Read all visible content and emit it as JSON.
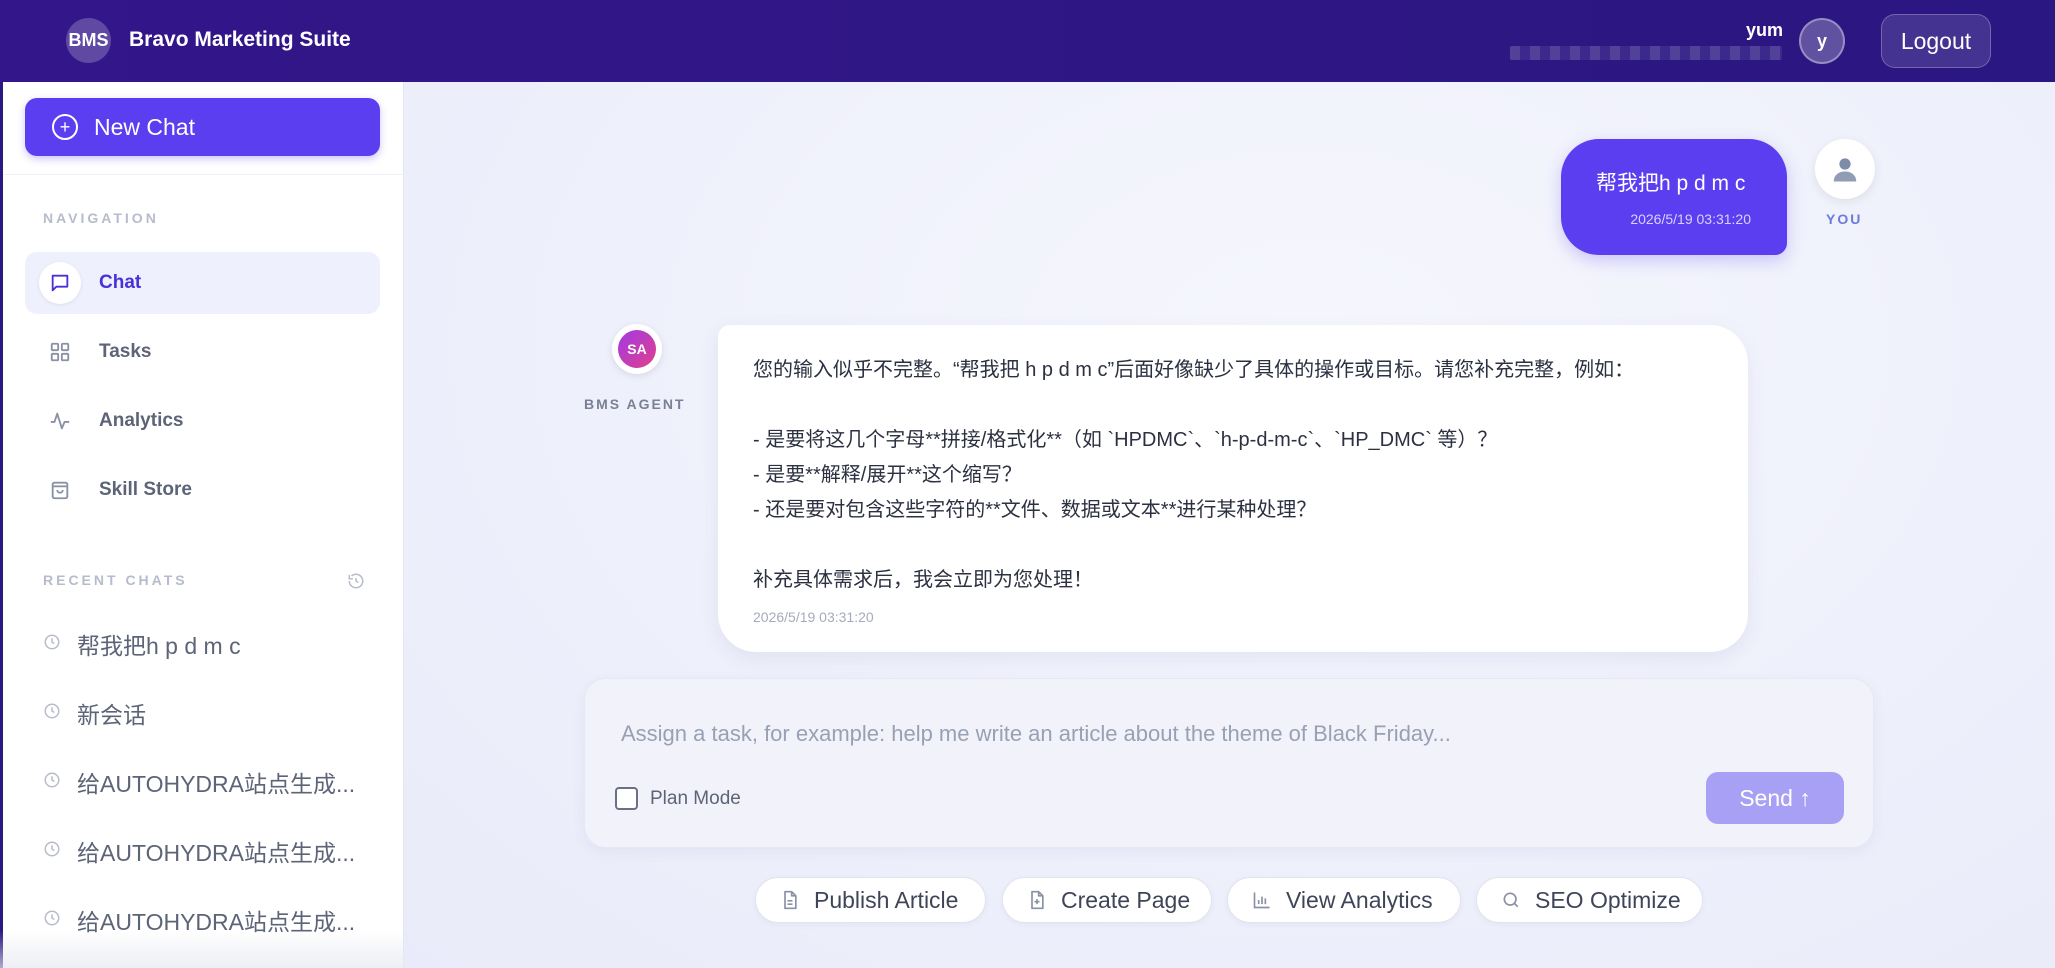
{
  "header": {
    "logo_text": "BMS",
    "app_title": "Bravo Marketing Suite",
    "user_name": "yum",
    "user_initial": "y",
    "logout_label": "Logout"
  },
  "sidebar": {
    "new_chat_label": "New Chat",
    "navigation_label": "NAVIGATION",
    "nav_items": [
      {
        "label": "Chat",
        "icon": "chat-bubble-icon",
        "active": true
      },
      {
        "label": "Tasks",
        "icon": "grid-icon",
        "active": false
      },
      {
        "label": "Analytics",
        "icon": "activity-icon",
        "active": false
      },
      {
        "label": "Skill Store",
        "icon": "shopping-bag-icon",
        "active": false
      }
    ],
    "recent_label": "RECENT CHATS",
    "recent_items": [
      "帮我把h p d m c",
      "新会话",
      "给AUTOHYDRA站点生成...",
      "给AUTOHYDRA站点生成...",
      "给AUTOHYDRA站点生成..."
    ]
  },
  "conversation": {
    "user_message": {
      "text": "帮我把h p d m c",
      "timestamp": "2026/5/19 03:31:20",
      "label": "YOU"
    },
    "agent_message": {
      "avatar_text": "SA",
      "label": "BMS AGENT",
      "lines": [
        "您的输入似乎不完整。“帮我把 h p d m c”后面好像缺少了具体的操作或目标。请您补充完整，例如：",
        "- 是要将这几个字母**拼接/格式化**（如 `HPDMC`、`h-p-d-m-c`、`HP_DMC` 等）？",
        "- 是要**解释/展开**这个缩写？",
        "- 还是要对包含这些字符的**文件、数据或文本**进行某种处理？",
        "补充具体需求后，我会立即为您处理！"
      ],
      "timestamp": "2026/5/19 03:31:20"
    }
  },
  "composer": {
    "placeholder": "Assign a task, for example: help me write an article about the theme of Black Friday...",
    "plan_mode_label": "Plan Mode",
    "send_label": "Send ↑"
  },
  "quick_actions": [
    {
      "label": "Publish Article",
      "icon": "document-icon"
    },
    {
      "label": "Create Page",
      "icon": "file-plus-icon"
    },
    {
      "label": "View Analytics",
      "icon": "bar-chart-icon"
    },
    {
      "label": "SEO Optimize",
      "icon": "search-icon"
    }
  ],
  "colors": {
    "header_bg": "#2e1784",
    "accent": "#5b3ef0",
    "send_disabled": "#a8a0f5"
  }
}
